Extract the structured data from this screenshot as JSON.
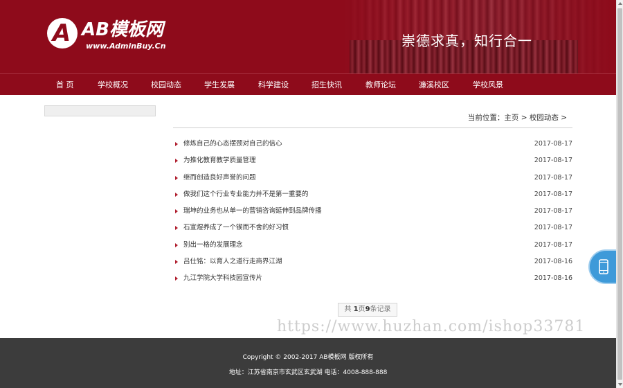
{
  "header": {
    "logo_letter": "A",
    "logo_text": "AB模板网",
    "logo_url": "www.AdminBuy.Cn",
    "slogan": "崇德求真，知行合一",
    "bg_color": "#8e0b1b"
  },
  "nav": {
    "items": [
      {
        "label": "首 页"
      },
      {
        "label": "学校概况"
      },
      {
        "label": "校园动态"
      },
      {
        "label": "学生发展"
      },
      {
        "label": "科学建设"
      },
      {
        "label": "招生快讯"
      },
      {
        "label": "教师论坛"
      },
      {
        "label": "濂溪校区"
      },
      {
        "label": "学校风景"
      }
    ]
  },
  "breadcrumb": {
    "prefix": "当前位置：",
    "home": "主页",
    "sep1": " > ",
    "section": "校园动态",
    "sep2": " >"
  },
  "news": [
    {
      "title": "修炼自己的心态摆颈对自己的信心",
      "date": "2017-08-17"
    },
    {
      "title": "为推化教育教学质量管理",
      "date": "2017-08-17"
    },
    {
      "title": "继而创造良好声誉的问题",
      "date": "2017-08-17"
    },
    {
      "title": "做我们这个行业专业能力并不是第一重要的",
      "date": "2017-08-17"
    },
    {
      "title": "瑞坤的业务也从单一的营销咨询延伸到品牌传播",
      "date": "2017-08-17"
    },
    {
      "title": "石宣煜养成了一个锲而不舍的好习惯",
      "date": "2017-08-17"
    },
    {
      "title": "别出一格的发展理念",
      "date": "2017-08-17"
    },
    {
      "title": "吕仕铭：以育人之道行走商界江湖",
      "date": "2017-08-16"
    },
    {
      "title": "九江学院大学科技园宣传片",
      "date": "2017-08-16"
    }
  ],
  "pager": {
    "pre": "共 ",
    "pages": "1",
    "mid": "页",
    "records": "9",
    "post": "条记录"
  },
  "watermark": "https://www.huzhan.com/ishop33781",
  "footer": {
    "copyright": "Copyright © 2002-2017 AB模板网 版权所有",
    "address": "地址：江苏省南京市玄武区玄武湖 电话：4008-888-888"
  },
  "float": {
    "icon": "mobile-phone-icon",
    "color": "#3e9ad9"
  }
}
